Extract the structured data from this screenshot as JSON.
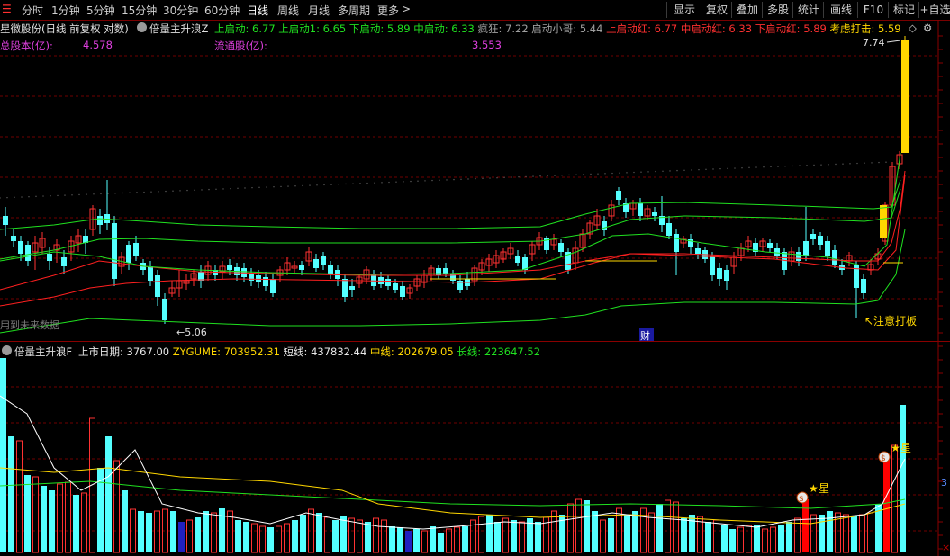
{
  "toolbar": {
    "periods": [
      "分时",
      "1分钟",
      "5分钟",
      "15分钟",
      "30分钟",
      "60分钟",
      "日线",
      "周线",
      "月线",
      "多周期",
      "更多"
    ],
    "active_period": "日线",
    "right_buttons": [
      "显示",
      "复权",
      "叠加",
      "多股",
      "统计",
      "画线",
      "F10",
      "标记",
      "+自选"
    ]
  },
  "stock": {
    "name_desc": "星徽股份(日线 前复权 对数)",
    "indicator_main": "倍量主升浪Z",
    "total_shares_label": "总股本(亿):",
    "total_shares": "4.578",
    "float_shares_label": "流通股(亿):",
    "float_shares": "3.553"
  },
  "main_indicator_values": [
    {
      "label": "上启动:",
      "value": "6.77",
      "color": "#20e020"
    },
    {
      "label": "上启动1:",
      "value": "6.65",
      "color": "#20e020"
    },
    {
      "label": "下启动:",
      "value": "5.89",
      "color": "#20e020"
    },
    {
      "label": "中启动:",
      "value": "6.33",
      "color": "#20e020"
    },
    {
      "label": "疯狂:",
      "value": "7.22",
      "color": "#a0a0a0"
    },
    {
      "label": "启动小哥:",
      "value": "5.44",
      "color": "#a0a0a0"
    },
    {
      "label": "上启动红:",
      "value": "6.77",
      "color": "#ff3030"
    },
    {
      "label": "中启动红:",
      "value": "6.33",
      "color": "#ff3030"
    },
    {
      "label": "下启动红:",
      "value": "5.89",
      "color": "#ff3030"
    },
    {
      "label": "考虑打击:",
      "value": "5.59",
      "color": "#ffd700"
    }
  ],
  "chart_labels": {
    "high_price": "7.74",
    "low_price": "5.06",
    "future_data": "用到未来数据",
    "finance_mark": "财",
    "board_note": "注意打板"
  },
  "sub_indicator": {
    "name": "倍量主升浪F",
    "values": [
      {
        "label": "上市日期:",
        "value": "3767.00",
        "color": "#e8e8e8"
      },
      {
        "label": "ZYGUME:",
        "value": "703952.31",
        "color": "#ffd700"
      },
      {
        "label": "短线:",
        "value": "437832.44",
        "color": "#e8e8e8"
      },
      {
        "label": "中线:",
        "value": "202679.05",
        "color": "#ffd700"
      },
      {
        "label": "长线:",
        "value": "223647.52",
        "color": "#20e020"
      }
    ],
    "star_label": "星",
    "right_scale_mark": "3"
  },
  "colors": {
    "up": "#ff3232",
    "down": "#54ffff",
    "ma_green": "#20e020",
    "ma_red": "#ff2020",
    "yellow": "#ffd700",
    "purple": "#e040e0"
  }
}
